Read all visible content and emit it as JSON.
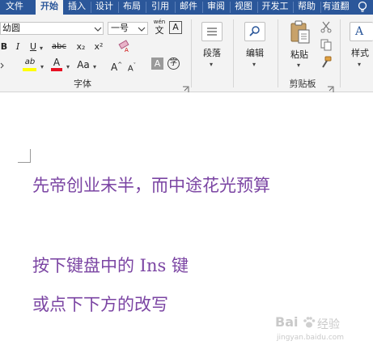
{
  "tabs": [
    {
      "label": "文件",
      "active": false
    },
    {
      "label": "开始",
      "active": true
    },
    {
      "label": "插入",
      "active": false
    },
    {
      "label": "设计",
      "active": false
    },
    {
      "label": "布局",
      "active": false
    },
    {
      "label": "引用",
      "active": false
    },
    {
      "label": "邮件",
      "active": false
    },
    {
      "label": "审阅",
      "active": false
    },
    {
      "label": "视图",
      "active": false
    },
    {
      "label": "开发工",
      "active": false
    },
    {
      "label": "帮助",
      "active": false
    },
    {
      "label": "有道翻",
      "active": false
    }
  ],
  "font_group": {
    "font_name": "幼圆",
    "font_size": "一号",
    "wen_label": "wén",
    "wen_char": "文",
    "border_char_label": "A",
    "bold": "B",
    "italic": "I",
    "underline": "U",
    "strikethrough": "abc",
    "subscript": "x₂",
    "superscript": "x²",
    "highlight": "ab",
    "font_color": "A",
    "change_case": "Aa",
    "grow_font": "A",
    "shrink_font": "A",
    "char_shading": "A",
    "enclose_char": "字",
    "label": "字体"
  },
  "paragraph_group": {
    "label": "段落"
  },
  "editing_group": {
    "label": "编辑"
  },
  "clipboard_group": {
    "paste_label": "粘贴",
    "label": "剪贴板"
  },
  "styles_group": {
    "label": "样式"
  },
  "document": {
    "lines": [
      "先帝创业未半，而中途花光预算",
      "按下键盘中的 Ins 键",
      "或点下下方的改写"
    ]
  },
  "watermark": {
    "brand": "Bai",
    "brand_suffix": "经验",
    "url": "jingyan.baidu.com"
  },
  "colors": {
    "tab_bar": "#2b579a",
    "ribbon": "#f3f3f3",
    "doc_text": "#7b45a3",
    "highlight_yellow": "#ffff00",
    "font_red": "#e81123"
  }
}
